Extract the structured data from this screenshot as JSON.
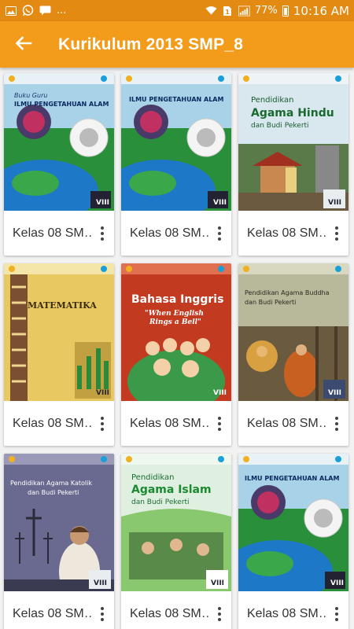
{
  "status_bar": {
    "notif_icons": [
      "image-icon",
      "whatsapp-icon",
      "message-icon"
    ],
    "overflow": "...",
    "battery": "77%",
    "time": "10:16 AM"
  },
  "app_bar": {
    "title": "Kurikulum 2013 SMP_8",
    "back_icon": "arrow-left-icon"
  },
  "books": [
    {
      "label": "Kelas 08 SM…",
      "cover": {
        "line1": "Buku Guru",
        "line2": "ILMU PENGETAHUAN ALAM",
        "kelas": "VIII"
      }
    },
    {
      "label": "Kelas 08 SM…",
      "cover": {
        "line1": "",
        "line2": "ILMU PENGETAHUAN ALAM",
        "kelas": "VIII"
      }
    },
    {
      "label": "Kelas 08 SM…",
      "cover": {
        "line1": "Pendidikan",
        "line2": "Agama Hindu",
        "line3": "dan Budi Pekerti",
        "kelas": "VIII"
      }
    },
    {
      "label": "Kelas 08 SM…",
      "cover": {
        "line1": "MATEMATIKA",
        "kelas": "VIII"
      }
    },
    {
      "label": "Kelas 08 SM…",
      "cover": {
        "line1": "Bahasa Inggris",
        "line2": "\"When English",
        "line3": "Rings a Bell\"",
        "kelas": "VIII"
      }
    },
    {
      "label": "Kelas 08 SM…",
      "cover": {
        "line1": "Pendidikan Agama Buddha",
        "line2": "dan Budi Pekerti",
        "kelas": "VIII"
      }
    },
    {
      "label": "Kelas 08 SM…",
      "cover": {
        "line1": "Pendidikan Agama Katolik",
        "line2": "dan Budi Pekerti",
        "kelas": "VIII"
      }
    },
    {
      "label": "Kelas 08 SM…",
      "cover": {
        "line1": "Pendidikan",
        "line2": "Agama Islam",
        "line3": "dan Budi Pekerti",
        "kelas": "VIII"
      }
    },
    {
      "label": "Kelas 08 SM…",
      "cover": {
        "line1": "ILMU PENGETAHUAN ALAM",
        "kelas": "VIII"
      }
    }
  ],
  "colors": {
    "status_bar": "#e28a12",
    "app_bar": "#f39c1b"
  }
}
